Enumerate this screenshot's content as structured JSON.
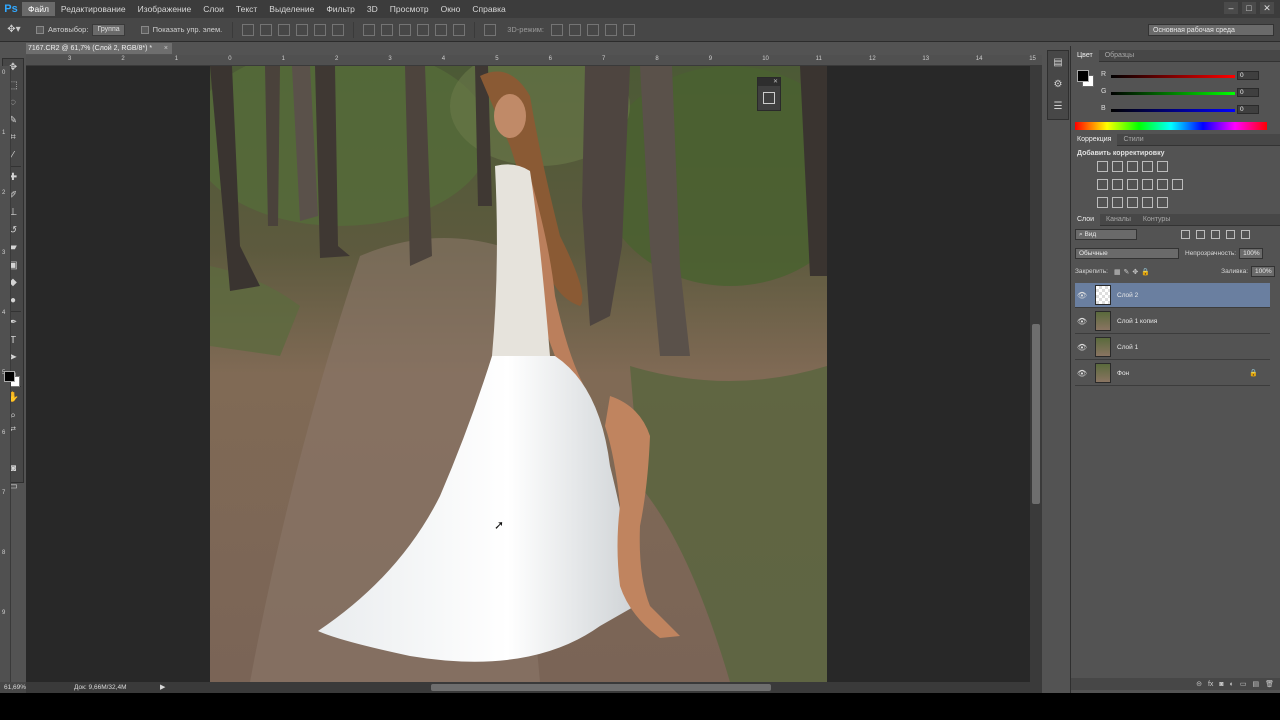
{
  "menubar": {
    "logo": "Ps",
    "items": [
      "Файл",
      "Редактирование",
      "Изображение",
      "Слои",
      "Текст",
      "Выделение",
      "Фильтр",
      "3D",
      "Просмотр",
      "Окно",
      "Справка"
    ],
    "window_buttons": [
      "–",
      "□",
      "✕"
    ]
  },
  "options": {
    "autoselect_label": "Автовыбор:",
    "autoselect_value": "Группа",
    "show_transform_label": "Показать упр. элем.",
    "mode_3d_label": "3D-режим:",
    "workspace": "Основная рабочая среда"
  },
  "document": {
    "tab_title": "7167.CR2 @ 61,7% (Слой 2, RGB/8*) *",
    "tab_close": "×"
  },
  "rulers": {
    "top": [
      "3",
      "2",
      "1",
      "0",
      "1",
      "2",
      "3",
      "4",
      "5",
      "6",
      "7",
      "8",
      "9",
      "10",
      "11",
      "12",
      "13",
      "14",
      "15"
    ],
    "left": [
      "0",
      "1",
      "2",
      "3",
      "4",
      "5",
      "6",
      "7",
      "8",
      "9"
    ]
  },
  "status": {
    "zoom": "61,69%",
    "doc": "Док: 9,66M/32,4M",
    "arrow": "▶"
  },
  "panels": {
    "color_tabs": [
      "Цвет",
      "Образцы"
    ],
    "color_channels": [
      {
        "label": "R",
        "value": "0",
        "gradient": "linear-gradient(to right,#000,#f00)"
      },
      {
        "label": "G",
        "value": "0",
        "gradient": "linear-gradient(to right,#000,#0f0)"
      },
      {
        "label": "B",
        "value": "0",
        "gradient": "linear-gradient(to right,#000,#00f)"
      }
    ],
    "adjust_tabs": [
      "Коррекция",
      "Стили"
    ],
    "adjust_title": "Добавить корректировку",
    "layers_tabs": [
      "Слои",
      "Каналы",
      "Контуры"
    ],
    "layers_filter": "Вид",
    "blend_mode": "Обычные",
    "opacity_label": "Непрозрачность:",
    "opacity_value": "100%",
    "lock_label": "Закрепить:",
    "fill_label": "Заливка:",
    "fill_value": "100%",
    "layers": [
      {
        "name": "Слой 2",
        "selected": true,
        "thumb": "checker",
        "locked": false
      },
      {
        "name": "Слой 1 копия",
        "selected": false,
        "thumb": "photo",
        "locked": false
      },
      {
        "name": "Слой 1",
        "selected": false,
        "thumb": "photo",
        "locked": false
      },
      {
        "name": "Фон",
        "selected": false,
        "thumb": "photo",
        "locked": true
      }
    ],
    "footer_icons": [
      "⊝",
      "fx",
      "◙",
      "◐",
      "▭",
      "▤",
      "🗑"
    ]
  },
  "colors": {
    "foreground": "#000000",
    "background": "#ffffff",
    "selection": "#6a7fa0"
  }
}
